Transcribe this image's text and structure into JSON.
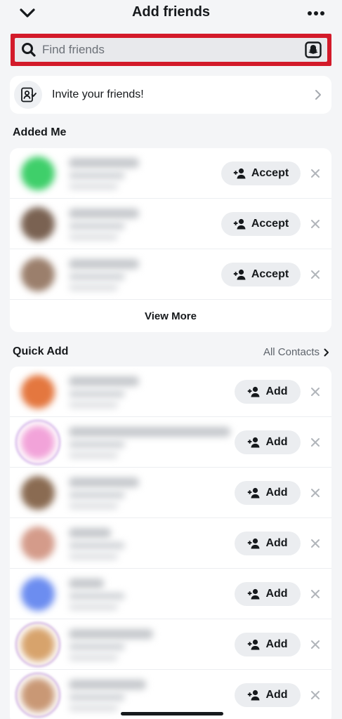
{
  "header": {
    "title": "Add friends",
    "back_icon": "chevron-down-icon",
    "more_icon": "more-horizontal-icon"
  },
  "search": {
    "placeholder": "Find friends",
    "value": "",
    "highlight_color": "#d31a2a"
  },
  "invite": {
    "label": "Invite your friends!"
  },
  "added_me": {
    "title": "Added Me",
    "accept_label": "Accept",
    "view_more_label": "View More",
    "rows": [
      {
        "avatar_color": "#3fcf6a"
      },
      {
        "avatar_color": "#7a6252"
      },
      {
        "avatar_color": "#9b7f6c"
      }
    ]
  },
  "quick_add": {
    "title": "Quick Add",
    "all_contacts_label": "All Contacts",
    "add_label": "Add",
    "rows": [
      {
        "avatar_color": "#e4773f",
        "story_ring": false
      },
      {
        "avatar_color": "#f2a3d9",
        "story_ring": true
      },
      {
        "avatar_color": "#8a6b52",
        "story_ring": false
      },
      {
        "avatar_color": "#d49b8a",
        "story_ring": false
      },
      {
        "avatar_color": "#6c8df0",
        "story_ring": false
      },
      {
        "avatar_color": "#d7a36c",
        "story_ring": true
      },
      {
        "avatar_color": "#c99875",
        "story_ring": true
      }
    ]
  },
  "colors": {
    "background": "#f4f5f7",
    "card": "#ffffff",
    "pill": "#ebedf0",
    "text": "#16191c"
  }
}
